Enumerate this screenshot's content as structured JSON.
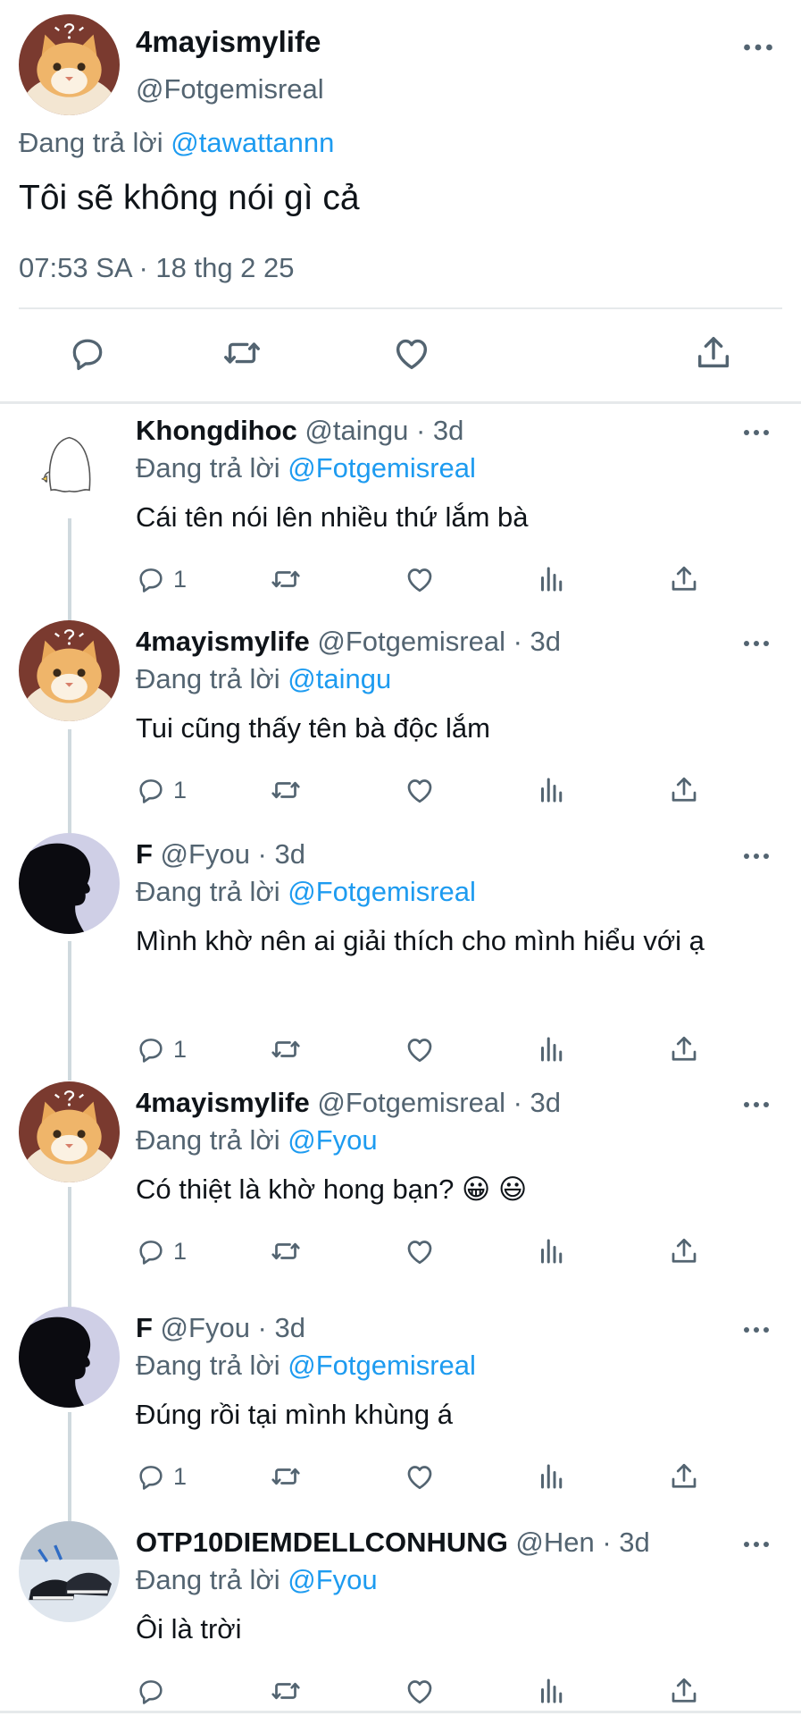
{
  "main_tweet": {
    "display_name": "4mayismylife",
    "handle": "@Fotgemisreal",
    "replying_prefix": "Đang trả lời",
    "replying_to": "@tawattannn",
    "text": "Tôi sẽ không nói gì cả",
    "timestamp": "07:53 SA · 18 thg 2 25",
    "actions": [
      "reply-icon",
      "retweet-icon",
      "like-icon",
      "share-icon"
    ]
  },
  "replies": [
    {
      "display_name": "Khongdihoc",
      "sub": " @taingu · 3d",
      "replying_prefix": "Đang trả lời",
      "replying_to": "@Fotgemisreal",
      "text": "Cái tên nói lên nhiều thứ lắm bà",
      "reply_count": "1",
      "avatar": "ghost-avatar"
    },
    {
      "display_name": "4mayismylife",
      "sub": " @Fotgemisreal · 3d",
      "replying_prefix": "Đang trả lời",
      "replying_to": "@taingu",
      "text": "Tui cũng thấy tên bà độc lắm",
      "reply_count": "1",
      "avatar": "cat-avatar"
    },
    {
      "display_name": "F",
      "sub": " @Fyou · 3d",
      "replying_prefix": "Đang trả lời",
      "replying_to": "@Fotgemisreal",
      "text": "Mình khờ nên ai giải thích cho mình hiểu với ạ",
      "reply_count": "1",
      "avatar": "silhouette-avatar"
    },
    {
      "display_name": "4mayismylife",
      "sub": " @Fotgemisreal · 3d",
      "replying_prefix": "Đang trả lời",
      "replying_to": "@Fyou",
      "text": "Có thiệt là khờ hong bạn? 😀 😃",
      "reply_count": "1",
      "avatar": "cat-avatar"
    },
    {
      "display_name": "F",
      "sub": " @Fyou · 3d",
      "replying_prefix": "Đang trả lời",
      "replying_to": "@Fotgemisreal",
      "text": "Đúng rồi tại mình khùng á",
      "reply_count": "1",
      "avatar": "silhouette-avatar"
    },
    {
      "display_name": "OTP10DIEMDELLCONHUNG",
      "sub": " @Hen · 3d",
      "replying_prefix": "Đang trả lời",
      "replying_to": "@Fyou",
      "text": "Ôi là trời",
      "reply_count": "",
      "avatar": "shoes-avatar"
    }
  ],
  "colors": {
    "accent": "#1d9bf0",
    "secondary_text": "#536471",
    "primary_text": "#0f1419",
    "divider": "#e6e9eb",
    "thread_line": "#cfd9de"
  }
}
